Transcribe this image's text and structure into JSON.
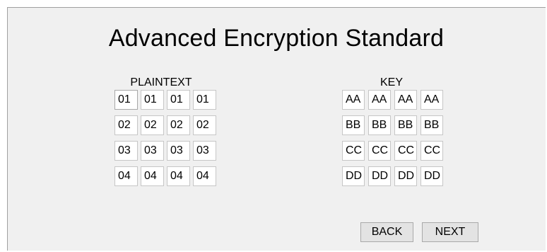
{
  "title": "Advanced Encryption Standard",
  "plaintext": {
    "label": "PLAINTEXT",
    "rows": [
      [
        "01",
        "01",
        "01",
        "01"
      ],
      [
        "02",
        "02",
        "02",
        "02"
      ],
      [
        "03",
        "03",
        "03",
        "03"
      ],
      [
        "04",
        "04",
        "04",
        "04"
      ]
    ]
  },
  "key": {
    "label": "KEY",
    "rows": [
      [
        "AA",
        "AA",
        "AA",
        "AA"
      ],
      [
        "BB",
        "BB",
        "BB",
        "BB"
      ],
      [
        "CC",
        "CC",
        "CC",
        "CC"
      ],
      [
        "DD",
        "DD",
        "DD",
        "DD"
      ]
    ]
  },
  "buttons": {
    "back_label": "BACK",
    "next_label": "NEXT"
  }
}
